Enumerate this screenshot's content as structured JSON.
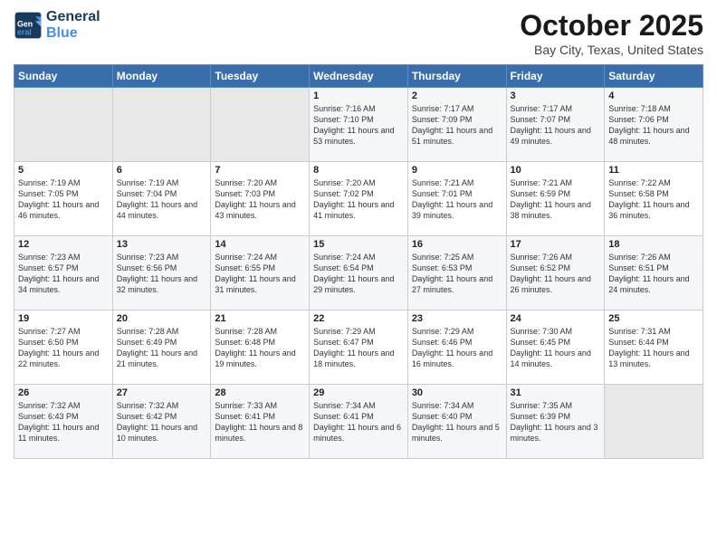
{
  "header": {
    "logo_line1": "General",
    "logo_line2": "Blue",
    "month": "October 2025",
    "location": "Bay City, Texas, United States"
  },
  "days_of_week": [
    "Sunday",
    "Monday",
    "Tuesday",
    "Wednesday",
    "Thursday",
    "Friday",
    "Saturday"
  ],
  "weeks": [
    [
      {
        "day": "",
        "empty": true
      },
      {
        "day": "",
        "empty": true
      },
      {
        "day": "",
        "empty": true
      },
      {
        "day": "1",
        "sunrise": "7:16 AM",
        "sunset": "7:10 PM",
        "daylight": "11 hours and 53 minutes."
      },
      {
        "day": "2",
        "sunrise": "7:17 AM",
        "sunset": "7:09 PM",
        "daylight": "11 hours and 51 minutes."
      },
      {
        "day": "3",
        "sunrise": "7:17 AM",
        "sunset": "7:07 PM",
        "daylight": "11 hours and 49 minutes."
      },
      {
        "day": "4",
        "sunrise": "7:18 AM",
        "sunset": "7:06 PM",
        "daylight": "11 hours and 48 minutes."
      }
    ],
    [
      {
        "day": "5",
        "sunrise": "7:19 AM",
        "sunset": "7:05 PM",
        "daylight": "11 hours and 46 minutes."
      },
      {
        "day": "6",
        "sunrise": "7:19 AM",
        "sunset": "7:04 PM",
        "daylight": "11 hours and 44 minutes."
      },
      {
        "day": "7",
        "sunrise": "7:20 AM",
        "sunset": "7:03 PM",
        "daylight": "11 hours and 43 minutes."
      },
      {
        "day": "8",
        "sunrise": "7:20 AM",
        "sunset": "7:02 PM",
        "daylight": "11 hours and 41 minutes."
      },
      {
        "day": "9",
        "sunrise": "7:21 AM",
        "sunset": "7:01 PM",
        "daylight": "11 hours and 39 minutes."
      },
      {
        "day": "10",
        "sunrise": "7:21 AM",
        "sunset": "6:59 PM",
        "daylight": "11 hours and 38 minutes."
      },
      {
        "day": "11",
        "sunrise": "7:22 AM",
        "sunset": "6:58 PM",
        "daylight": "11 hours and 36 minutes."
      }
    ],
    [
      {
        "day": "12",
        "sunrise": "7:23 AM",
        "sunset": "6:57 PM",
        "daylight": "11 hours and 34 minutes."
      },
      {
        "day": "13",
        "sunrise": "7:23 AM",
        "sunset": "6:56 PM",
        "daylight": "11 hours and 32 minutes."
      },
      {
        "day": "14",
        "sunrise": "7:24 AM",
        "sunset": "6:55 PM",
        "daylight": "11 hours and 31 minutes."
      },
      {
        "day": "15",
        "sunrise": "7:24 AM",
        "sunset": "6:54 PM",
        "daylight": "11 hours and 29 minutes."
      },
      {
        "day": "16",
        "sunrise": "7:25 AM",
        "sunset": "6:53 PM",
        "daylight": "11 hours and 27 minutes."
      },
      {
        "day": "17",
        "sunrise": "7:26 AM",
        "sunset": "6:52 PM",
        "daylight": "11 hours and 26 minutes."
      },
      {
        "day": "18",
        "sunrise": "7:26 AM",
        "sunset": "6:51 PM",
        "daylight": "11 hours and 24 minutes."
      }
    ],
    [
      {
        "day": "19",
        "sunrise": "7:27 AM",
        "sunset": "6:50 PM",
        "daylight": "11 hours and 22 minutes."
      },
      {
        "day": "20",
        "sunrise": "7:28 AM",
        "sunset": "6:49 PM",
        "daylight": "11 hours and 21 minutes."
      },
      {
        "day": "21",
        "sunrise": "7:28 AM",
        "sunset": "6:48 PM",
        "daylight": "11 hours and 19 minutes."
      },
      {
        "day": "22",
        "sunrise": "7:29 AM",
        "sunset": "6:47 PM",
        "daylight": "11 hours and 18 minutes."
      },
      {
        "day": "23",
        "sunrise": "7:29 AM",
        "sunset": "6:46 PM",
        "daylight": "11 hours and 16 minutes."
      },
      {
        "day": "24",
        "sunrise": "7:30 AM",
        "sunset": "6:45 PM",
        "daylight": "11 hours and 14 minutes."
      },
      {
        "day": "25",
        "sunrise": "7:31 AM",
        "sunset": "6:44 PM",
        "daylight": "11 hours and 13 minutes."
      }
    ],
    [
      {
        "day": "26",
        "sunrise": "7:32 AM",
        "sunset": "6:43 PM",
        "daylight": "11 hours and 11 minutes."
      },
      {
        "day": "27",
        "sunrise": "7:32 AM",
        "sunset": "6:42 PM",
        "daylight": "11 hours and 10 minutes."
      },
      {
        "day": "28",
        "sunrise": "7:33 AM",
        "sunset": "6:41 PM",
        "daylight": "11 hours and 8 minutes."
      },
      {
        "day": "29",
        "sunrise": "7:34 AM",
        "sunset": "6:41 PM",
        "daylight": "11 hours and 6 minutes."
      },
      {
        "day": "30",
        "sunrise": "7:34 AM",
        "sunset": "6:40 PM",
        "daylight": "11 hours and 5 minutes."
      },
      {
        "day": "31",
        "sunrise": "7:35 AM",
        "sunset": "6:39 PM",
        "daylight": "11 hours and 3 minutes."
      },
      {
        "day": "",
        "empty": true
      }
    ]
  ]
}
